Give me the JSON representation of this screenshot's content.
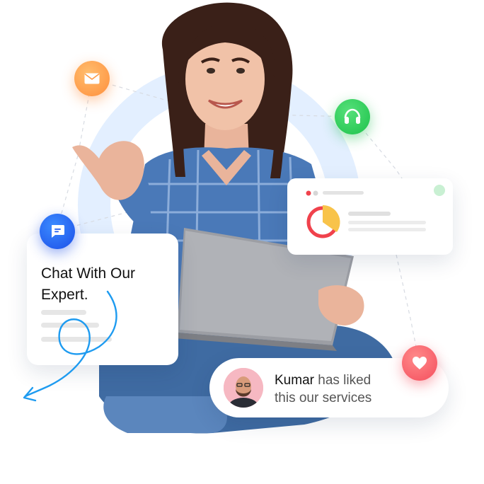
{
  "chat_card": {
    "title": "Chat With Our Expert."
  },
  "like_card": {
    "name": "Kumar",
    "message_part1": "has liked",
    "message_part2": "this our services"
  },
  "icons": {
    "mail": "mail-icon",
    "headset": "headset-icon",
    "chat": "chat-bubble-icon",
    "heart": "heart-icon"
  },
  "colors": {
    "mail": "#ff9b47",
    "headset": "#22c650",
    "chat": "#1f5cf0",
    "heart": "#f45261",
    "accent_blue": "#1e9bf0",
    "donut_red": "#f0424c",
    "donut_yellow": "#f8c34a",
    "circle_bg": "#e3efff"
  },
  "stats_card": {
    "donut_share_yellow": 0.33
  }
}
